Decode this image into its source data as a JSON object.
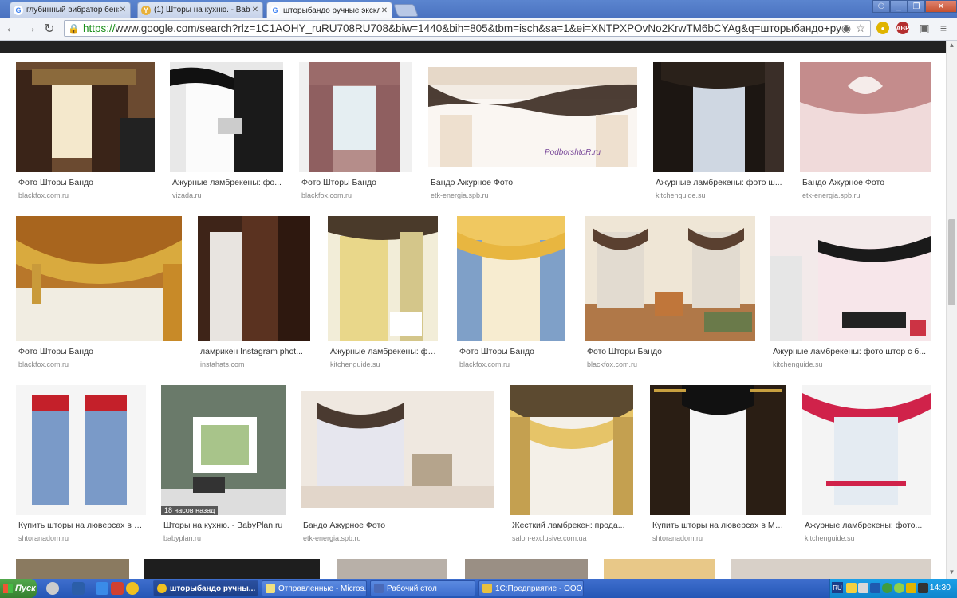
{
  "tabs": [
    {
      "title": "глубинный вибратор бенз",
      "favicon": "G",
      "active": false
    },
    {
      "title": "(1) Шторы на кухню. - Bab",
      "favicon": "Y",
      "active": false
    },
    {
      "title": "шторыбандо ручные эксклю",
      "favicon": "G",
      "active": true
    }
  ],
  "omnibox": {
    "scheme": "https://",
    "rest": "www.google.com/search?rlz=1C1AOHY_ruRU708RU708&biw=1440&bih=805&tbm=isch&sa=1&ei=XNTPXPOvNo2KrwTM6bCYAg&q=шторыбандо+ру"
  },
  "extensions": [
    "ABP"
  ],
  "results": {
    "row1": [
      {
        "caption": "Фото Шторы Бандо",
        "source": "blackfox.com.ru"
      },
      {
        "caption": "Ажурные ламбрекены: фо...",
        "source": "vizada.ru"
      },
      {
        "caption": "Фото Шторы Бандо",
        "source": "blackfox.com.ru"
      },
      {
        "caption": "Бандо Ажурное Фото",
        "source": "etk-energia.spb.ru",
        "watermark": "PodborshtoR.ru"
      },
      {
        "caption": "Ажурные ламбрекены: фото ш...",
        "source": "kitchenguide.su"
      },
      {
        "caption": "Бандо Ажурное Фото",
        "source": "etk-energia.spb.ru"
      }
    ],
    "row2": [
      {
        "caption": "Фото Шторы Бандо",
        "source": "blackfox.com.ru"
      },
      {
        "caption": "ламрикен Instagram phot...",
        "source": "instahats.com"
      },
      {
        "caption": "Ажурные ламбрекены: фо...",
        "source": "kitchenguide.su"
      },
      {
        "caption": "Фото Шторы Бандо",
        "source": "blackfox.com.ru"
      },
      {
        "caption": "Фото Шторы Бандо",
        "source": "blackfox.com.ru"
      },
      {
        "caption": "Ажурные ламбрекены: фото штор с б...",
        "source": "kitchenguide.su"
      }
    ],
    "row3": [
      {
        "caption": "Купить шторы на люверсах в М...",
        "source": "shtoranadom.ru"
      },
      {
        "caption": "Шторы на кухню. - BabyPlan.ru",
        "source": "babyplan.ru",
        "badge": "18 часов назад"
      },
      {
        "caption": "Бандо Ажурное Фото",
        "source": "etk-energia.spb.ru"
      },
      {
        "caption": "Жесткий ламбрекен: прода...",
        "source": "salon-exclusive.com.ua"
      },
      {
        "caption": "Купить шторы на люверсах в Мо...",
        "source": "shtoranadom.ru"
      },
      {
        "caption": "Ажурные ламбрекены: фото...",
        "source": "kitchenguide.su"
      }
    ]
  },
  "taskbar": {
    "start_label": "Пуск",
    "items": [
      {
        "label": "шторыбандо ручны...",
        "active": true
      },
      {
        "label": "Отправленные - Micros...",
        "active": false
      },
      {
        "label": "Рабочий стол",
        "active": false
      },
      {
        "label": "1С:Предприятие - ООО...",
        "active": false
      }
    ],
    "lang": "RU",
    "clock": "14:30"
  },
  "colors": {
    "tabstrip": "#4a72c0",
    "https_green": "#1a8f1a",
    "taskbar": "#2456b6",
    "darkbar": "#222222"
  }
}
